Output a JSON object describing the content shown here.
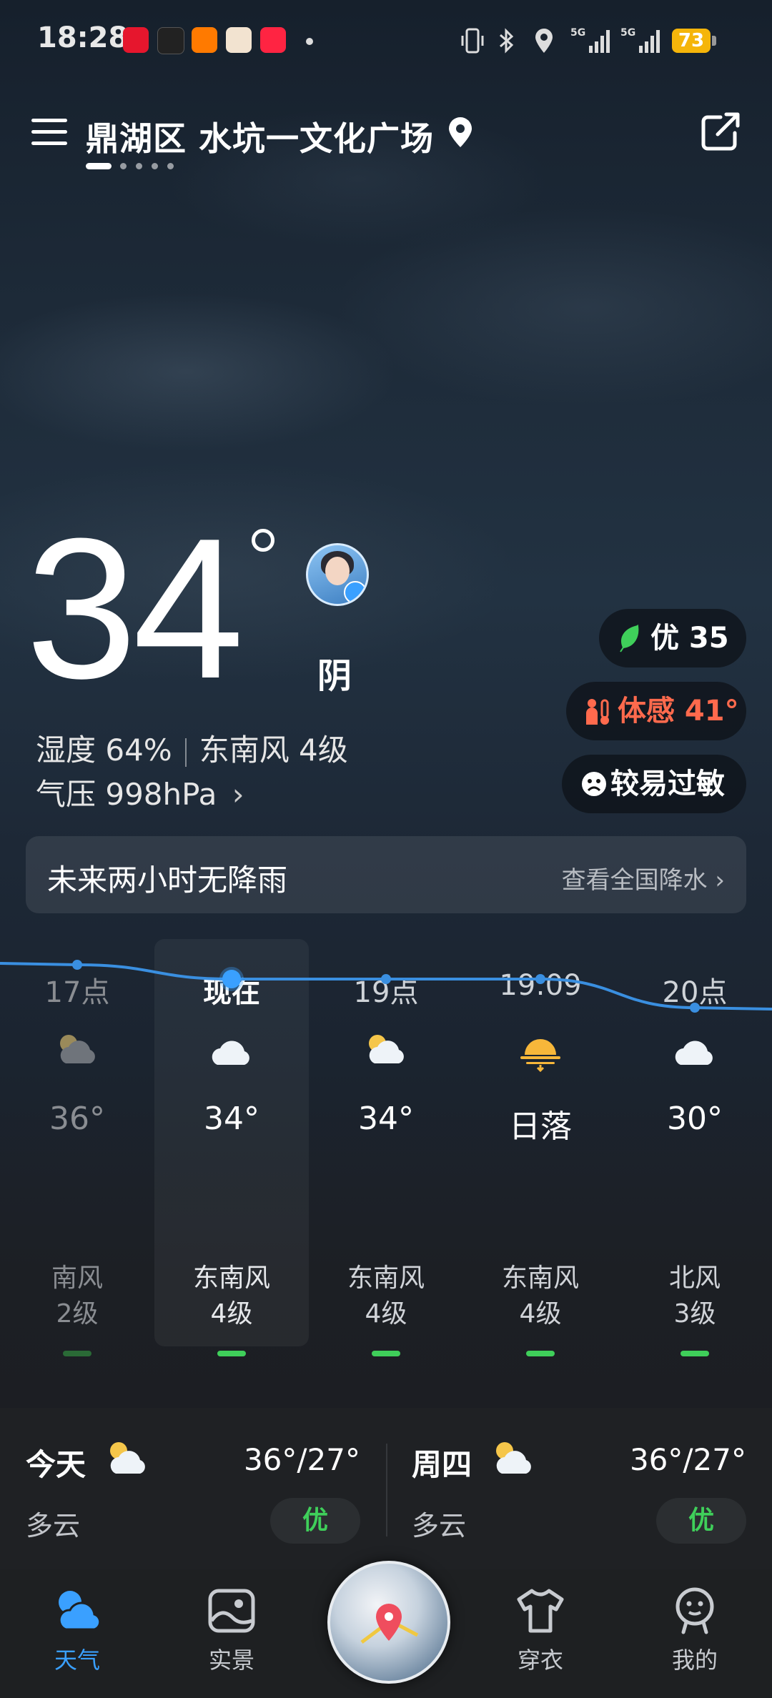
{
  "status_bar": {
    "time": "18:28",
    "battery": "73",
    "notif_apps": [
      "weibo-icon",
      "huya-icon",
      "taobao-icon",
      "tiktok-icon",
      "xiaohongshu-icon"
    ],
    "net_labels": [
      "5G",
      "5G"
    ]
  },
  "header": {
    "location": "鼎湖区 水坑一文化广场",
    "page_count": 5,
    "active_page": 0
  },
  "current": {
    "temperature": "34",
    "condition": "阴",
    "humidity": "湿度 64%",
    "wind": "东南风 4级",
    "pressure": "气压 998hPa",
    "aqi_label": "优 35",
    "feels_like": "体感 41°",
    "allergy": "较易过敏"
  },
  "rain": {
    "message": "未来两小时无降雨",
    "link": "查看全国降水"
  },
  "hourly": [
    {
      "time": "17点",
      "icon": "partly-cloudy-icon",
      "temp": "36°",
      "wind": "南风",
      "level": "2级",
      "past": true
    },
    {
      "time": "现在",
      "icon": "cloudy-icon",
      "temp": "34°",
      "wind": "东南风",
      "level": "4级",
      "now": true
    },
    {
      "time": "19点",
      "icon": "partly-cloudy-icon",
      "temp": "34°",
      "wind": "东南风",
      "level": "4级"
    },
    {
      "time": "19:09",
      "icon": "sunset-icon",
      "temp": "日落",
      "wind": "东南风",
      "level": "4级"
    },
    {
      "time": "20点",
      "icon": "cloudy-icon",
      "temp": "30°",
      "wind": "北风",
      "level": "3级"
    }
  ],
  "hourly_temps": [
    36,
    34,
    34,
    34,
    30
  ],
  "daily": [
    {
      "day": "今天",
      "condition": "多云",
      "range": "36°/27°",
      "quality": "优"
    },
    {
      "day": "周四",
      "condition": "多云",
      "range": "36°/27°",
      "quality": "优"
    }
  ],
  "nav": {
    "items": [
      {
        "label": "天气",
        "icon": "weather-icon",
        "active": true
      },
      {
        "label": "实景",
        "icon": "gallery-icon"
      },
      {
        "label": "穿衣",
        "icon": "tshirt-icon"
      },
      {
        "label": "我的",
        "icon": "profile-icon"
      }
    ],
    "center_icon": "map-pin-icon"
  },
  "colors": {
    "accent": "#3aa0ff",
    "good": "#3fcf5a",
    "hot": "#ff6a4d",
    "battery": "#f5b50a"
  }
}
